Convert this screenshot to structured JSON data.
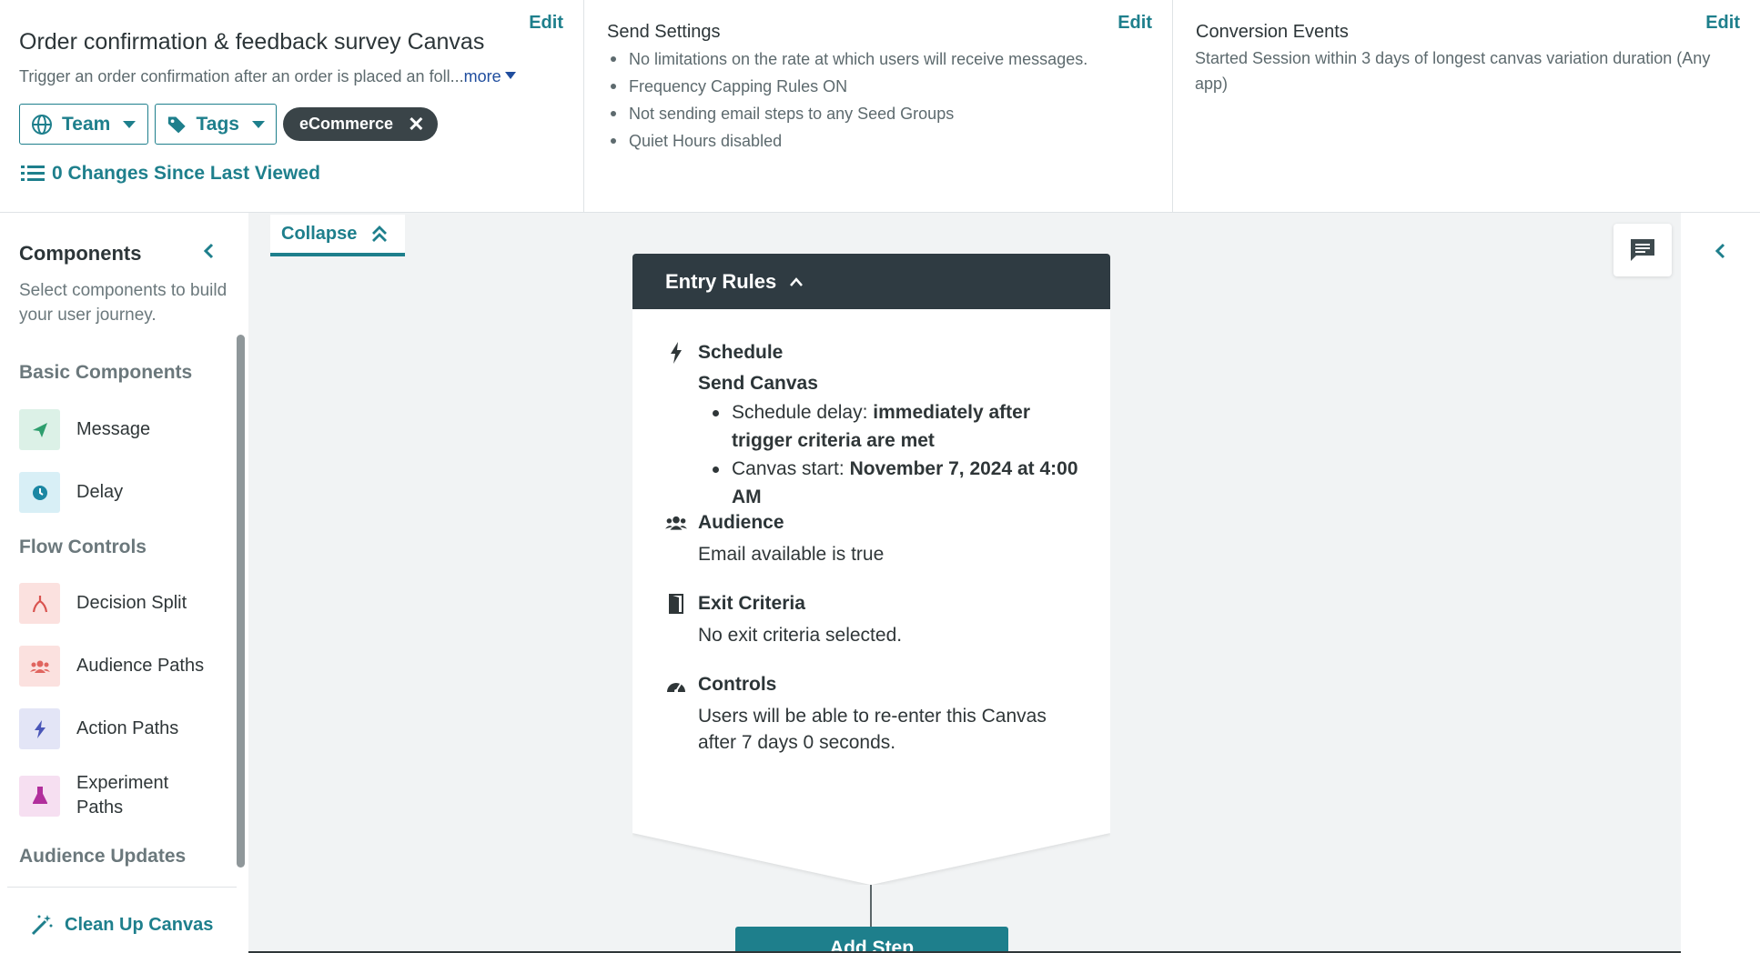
{
  "header": {
    "canvas": {
      "title": "Order confirmation & feedback survey Canvas",
      "description": "Trigger an order confirmation after an order is placed an foll...",
      "more_label": "more",
      "edit_label": "Edit",
      "team_label": "Team",
      "tags_label": "Tags",
      "tag": "eCommerce",
      "changes_label": "0 Changes Since Last Viewed"
    },
    "send_settings": {
      "title": "Send Settings",
      "edit_label": "Edit",
      "items": [
        "No limitations on the rate at which users will receive messages.",
        "Frequency Capping Rules ON",
        "Not sending email steps to any Seed Groups",
        "Quiet Hours disabled"
      ]
    },
    "conversion": {
      "title": "Conversion Events",
      "edit_label": "Edit",
      "text": "Started Session within 3 days of longest canvas variation duration (Any app)"
    }
  },
  "sidebar": {
    "title": "Components",
    "description": "Select components to build your user journey.",
    "sections": {
      "basic": "Basic Components",
      "flow": "Flow Controls",
      "audience": "Audience Updates"
    },
    "items": [
      {
        "label": "Message",
        "icon": "send-icon",
        "color": "#2e9e6e",
        "bg": "#dcf1e7"
      },
      {
        "label": "Delay",
        "icon": "clock-icon",
        "color": "#1b87a3",
        "bg": "#d8eff6"
      },
      {
        "label": "Decision Split",
        "icon": "split-icon",
        "color": "#d9534f",
        "bg": "#fbe1df"
      },
      {
        "label": "Audience Paths",
        "icon": "users-icon",
        "color": "#e0655f",
        "bg": "#fbe1df"
      },
      {
        "label": "Action Paths",
        "icon": "bolt-icon",
        "color": "#4a56b8",
        "bg": "#e3e5f6"
      },
      {
        "label": "Experiment Paths",
        "icon": "flask-icon",
        "color": "#b12f9c",
        "bg": "#f6dff1"
      }
    ],
    "cleanup_label": "Clean Up Canvas"
  },
  "canvas": {
    "collapse_label": "Collapse",
    "entry_rules": {
      "title": "Entry Rules",
      "schedule": {
        "title": "Schedule",
        "subtitle": "Send Canvas",
        "delay_prefix": "Schedule delay: ",
        "delay_value": "immediately after trigger criteria are met",
        "start_prefix": "Canvas start: ",
        "start_value": "November 7, 2024 at 4:00 AM"
      },
      "audience": {
        "title": "Audience",
        "text": "Email available is true"
      },
      "exit": {
        "title": "Exit Criteria",
        "text": "No exit criteria selected."
      },
      "controls": {
        "title": "Controls",
        "text": "Users will be able to re-enter this Canvas after 7 days 0 seconds."
      }
    },
    "add_step_label": "Add Step"
  },
  "colors": {
    "accent": "#1e7f8c",
    "dark_header": "#2f3b42",
    "canvas_bg": "#f1f3f4"
  }
}
